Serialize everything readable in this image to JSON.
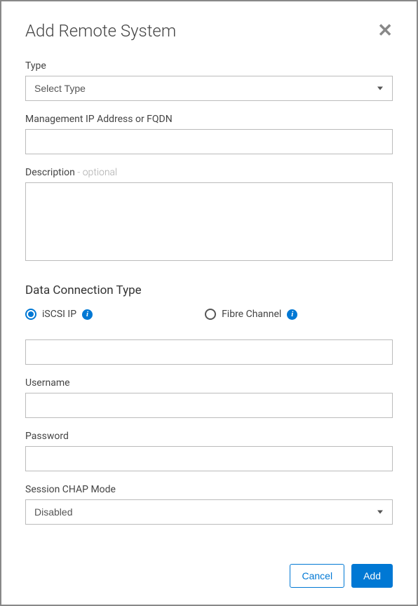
{
  "dialog": {
    "title": "Add Remote System",
    "form": {
      "type": {
        "label": "Type",
        "selected": "Select Type"
      },
      "management_ip": {
        "label": "Management IP Address or FQDN",
        "value": ""
      },
      "description": {
        "label": "Description",
        "optional_suffix": " - optional",
        "value": ""
      },
      "data_connection": {
        "section_title": "Data Connection Type",
        "options": [
          {
            "label": "iSCSI IP",
            "checked": true
          },
          {
            "label": "Fibre Channel",
            "checked": false
          }
        ],
        "address_value": ""
      },
      "username": {
        "label": "Username",
        "value": ""
      },
      "password": {
        "label": "Password",
        "value": ""
      },
      "session_chap": {
        "label": "Session CHAP Mode",
        "selected": "Disabled"
      }
    },
    "buttons": {
      "cancel": "Cancel",
      "add": "Add"
    }
  }
}
